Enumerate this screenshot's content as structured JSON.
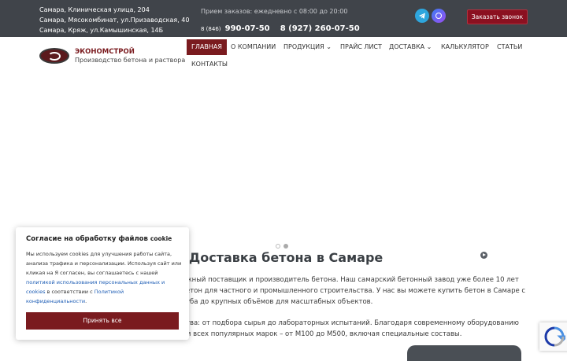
{
  "topbar": {
    "addresses": [
      "Самара, Клиническая улица, 204",
      "Самара, Мясокомбинат, ул.Призаводская, 40",
      "Самара, Кряж, ул.Камышинская, 14Б"
    ],
    "hours": "Прием заказов: ежедневно с 08:00 до 20:00",
    "phone1_code": "8 (846)",
    "phone1": "990-07-50",
    "phone2": "8 (927) 260-07-50",
    "call_button": "Заказать звонок"
  },
  "header": {
    "brand": "ЭКОНОМСТРОЙ",
    "tagline": "Производство бетона и раствора"
  },
  "nav": {
    "items": [
      {
        "label": "ГЛАВНАЯ"
      },
      {
        "label": "О КОМПАНИИ"
      },
      {
        "label": "ПРОДУКЦИЯ ⌄"
      },
      {
        "label": "ПРАЙС ЛИСТ"
      },
      {
        "label": "ДОСТАВКА ⌄"
      },
      {
        "label": "КАЛЬКУЛЯТОР"
      },
      {
        "label": "СТАТЬИ"
      },
      {
        "label": "КОНТАКТЫ"
      }
    ],
    "active": "ГЛАВНАЯ"
  },
  "main": {
    "title": "Доставка бетона в Самаре",
    "paragraph_lines": [
      "жный поставщик и производитель бетона. Наш самарский бетонный завод уже более 10 лет",
      "етон для частного и промышленного строительства. У нас вы можете купить бетон в Самаре с",
      "уба до крупных объёмов для масштабных объектов.",
      "тва: от подбора сырья до лабораторных испытаний. Благодаря современному оборудованию",
      "м всех популярных марок – от М100 до М500, включая специальные составы."
    ]
  },
  "cookie": {
    "title": "Согласие на обработку файлов",
    "title_suffix": "cookie",
    "text1": "Мы используем cookies для улучшения работы сайта, анализа трафика и персонализации. Используя сайт или кликая на Я согласен, вы соглашаетесь с нашей ",
    "link1": "политикой использования персональных данных и cookies",
    "text2": " в соответствии с ",
    "link2": "Политикой конфиденциальности",
    "text3": ".",
    "accept": "Принять все"
  },
  "colors": {
    "topbar_bg": "#40444a",
    "accent": "#7a1b1f",
    "link": "#1d5db5"
  }
}
